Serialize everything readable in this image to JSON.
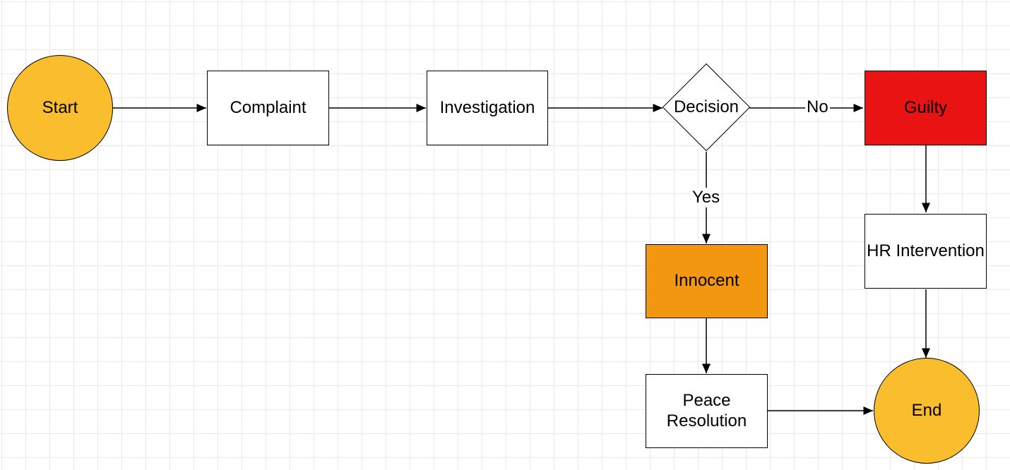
{
  "nodes": {
    "start": {
      "label": "Start"
    },
    "complaint": {
      "label": "Complaint"
    },
    "investigation": {
      "label": "Investigation"
    },
    "decision": {
      "label": "Decision"
    },
    "guilty": {
      "label": "Guilty"
    },
    "innocent": {
      "label": "Innocent"
    },
    "hr": {
      "label": "HR Intervention"
    },
    "peace": {
      "label": "Peace Resolution"
    },
    "end": {
      "label": "End"
    }
  },
  "edges": {
    "decision_yes": "Yes",
    "decision_no": "No"
  },
  "colors": {
    "start_fill": "#fabd2e",
    "end_fill": "#fabd2e",
    "guilty_fill": "#e91313",
    "innocent_fill": "#f2970f"
  }
}
